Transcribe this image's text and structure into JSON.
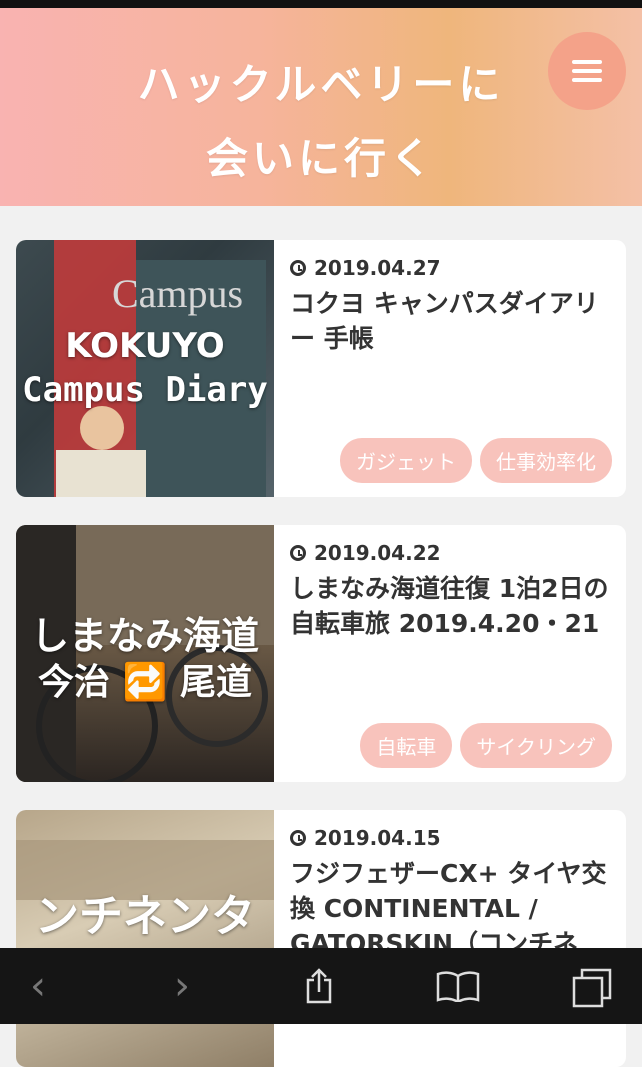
{
  "header": {
    "title_line1": "ハックルベリーに",
    "title_line2": "会いに行く"
  },
  "posts": [
    {
      "date": "2019.04.27",
      "title": "コクヨ キャンパスダイアリー 手帳",
      "thumb_text_1": "KOKUYO",
      "thumb_text_2": "Campus Diary",
      "tags": [
        "ガジェット",
        "仕事効率化"
      ]
    },
    {
      "date": "2019.04.22",
      "title": "しまなみ海道往復 1泊2日の自転車旅 2019.4.20・21",
      "thumb_text_1": "しまなみ海道",
      "thumb_text_2": "今治 🔁 尾道",
      "tags": [
        "自転車",
        "サイクリング"
      ]
    },
    {
      "date": "2019.04.15",
      "title": "フジフェザーCX+ タイヤ交換 CONTINENTAL / GATORSKIN（コンチネ",
      "thumb_text_1": "ンチネンタ",
      "tags": []
    }
  ],
  "toolbar": {
    "back": "‹",
    "forward": "›"
  },
  "icons": {
    "menu": "hamburger-icon",
    "clock": "clock-icon",
    "share": "share-icon",
    "bookmarks": "book-icon",
    "tabs": "tabs-icon"
  }
}
